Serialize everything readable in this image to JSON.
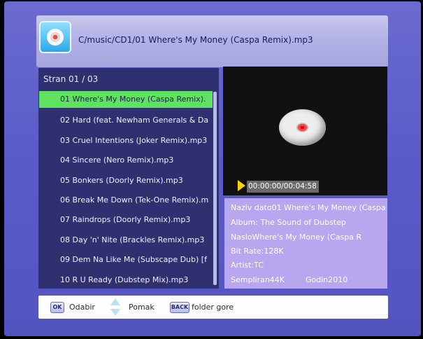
{
  "header": {
    "path": "C/music/CD1/01 Where's My Money (Caspa Remix).mp3"
  },
  "list": {
    "page_label": "Stran  01 / 03",
    "items": [
      "01 Where's My Money (Caspa Remix).",
      "02 Hard (feat. Newham Generals & Da",
      "03 Cruel Intentions (Joker Remix).mp3",
      "04 Sincere (Nero Remix).mp3",
      "05 Bonkers (Doorly Remix).mp3",
      "06 Break Me Down (Tek-One Remix).m",
      "07 Raindrops (Doorly Remix).mp3",
      "08 Day 'n' Nite (Brackles Remix).mp3",
      "09 Dem Na Like Me (Subscape Dub) [f",
      "10 R U Ready (Dubstep Mix).mp3"
    ],
    "selected_index": 0
  },
  "player": {
    "time": "00:00:00/00:04:58"
  },
  "info": {
    "title_line": "Naziv dato01 Where's My Money (Caspa",
    "album_line": "Album: The Sound of Dubstep",
    "naslov_line": "NasloWhere's My Money (Caspa R",
    "bitrate_line": "Bit Rate:128K",
    "artist_line": "Artist:TC",
    "sample_line": "Sempliran44K",
    "year_line": "Godin2010"
  },
  "footer": {
    "ok_key": "OK",
    "ok_label": "Odabir",
    "move_label": "Pomak",
    "back_key": "BACK",
    "back_label": "folder gore"
  },
  "colors": {
    "background": "#5a5ac8",
    "highlight": "#5fe25f",
    "list_bg": "#2e3070",
    "info_bg": "#b8a6ee"
  }
}
